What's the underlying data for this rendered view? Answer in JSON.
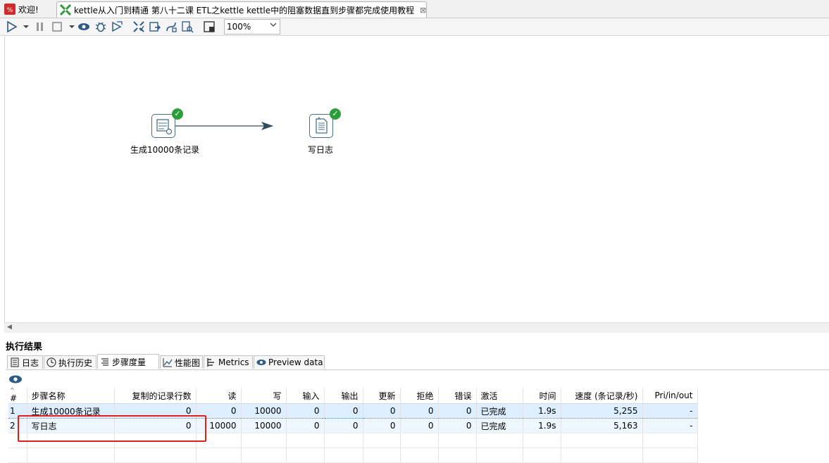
{
  "tabs": [
    {
      "label": "欢迎!"
    },
    {
      "label": "kettle从入门到精通 第八十二课 ETL之kettle kettle中的阻塞数据直到步骤都完成使用教程",
      "close": "⊠"
    }
  ],
  "toolbar": {
    "zoom_value": "100%"
  },
  "canvas": {
    "steps": [
      {
        "label": "生成10000条记录",
        "icon": "generate-rows-icon"
      },
      {
        "label": "写日志",
        "icon": "write-log-icon"
      }
    ]
  },
  "results": {
    "title": "执行结果",
    "tabs": [
      "日志",
      "执行历史",
      "步骤度量",
      "性能图",
      "Metrics",
      "Preview data"
    ],
    "active_tab": "步骤度量",
    "columns": [
      "#",
      "步骤名称",
      "复制的记录行数",
      "读",
      "写",
      "输入",
      "输出",
      "更新",
      "拒绝",
      "错误",
      "激活",
      "时间",
      "速度 (条记录/秒)",
      "Pri/in/out"
    ],
    "rows": [
      {
        "idx": "1",
        "name": "生成10000条记录",
        "copies": "0",
        "read": "0",
        "written": "10000",
        "input": "0",
        "output": "0",
        "updated": "0",
        "rejected": "0",
        "errors": "0",
        "status": "已完成",
        "time": "1.9s",
        "speed": "5,255",
        "pri": "-"
      },
      {
        "idx": "2",
        "name": "写日志",
        "copies": "0",
        "read": "10000",
        "written": "10000",
        "input": "0",
        "output": "0",
        "updated": "0",
        "rejected": "0",
        "errors": "0",
        "status": "已完成",
        "time": "1.9s",
        "speed": "5,163",
        "pri": "-"
      }
    ]
  },
  "colors": {
    "success": "#2b9e3a",
    "highlight": "#e02020",
    "selected_row": "#dceeff"
  }
}
